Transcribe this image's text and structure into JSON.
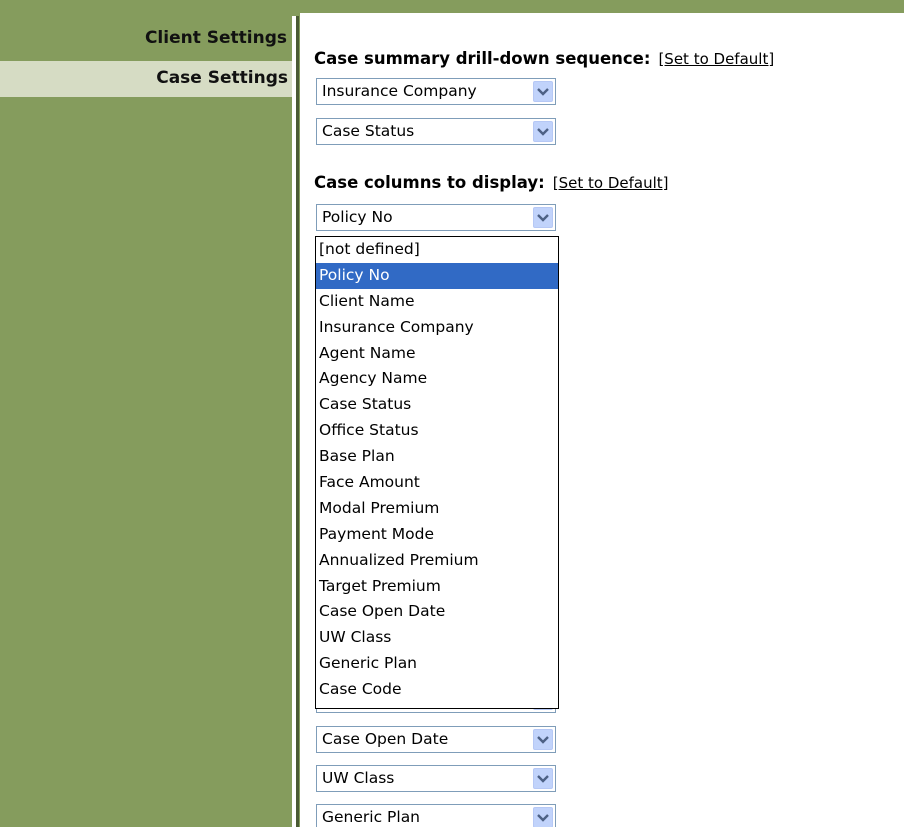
{
  "sidebar": {
    "items": [
      {
        "label": "Client Settings"
      },
      {
        "label": "Case Settings"
      }
    ]
  },
  "drilldown": {
    "title": "Case summary drill-down sequence:",
    "default_link": "[Set to Default]",
    "selects": [
      "Insurance Company",
      "Case Status"
    ]
  },
  "columns": {
    "title": "Case columns to display:",
    "default_link": "[Set to Default]",
    "open_select_value": "Policy No",
    "options": [
      "[not defined]",
      "Policy No",
      "Client Name",
      "Insurance Company",
      "Agent Name",
      "Agency Name",
      "Case Status",
      "Office Status",
      "Base Plan",
      "Face Amount",
      "Modal Premium",
      "Payment Mode",
      "Annualized Premium",
      "Target Premium",
      "Case Open Date",
      "UW Class",
      "Generic Plan",
      "Case Code"
    ],
    "selected_option": "Policy No",
    "below_selects": [
      "Case Open Date",
      "UW Class",
      "Generic Plan"
    ]
  },
  "colors": {
    "frame": "#859c5d",
    "active_nav": "#d6dcc4",
    "selection": "#316ac5"
  }
}
